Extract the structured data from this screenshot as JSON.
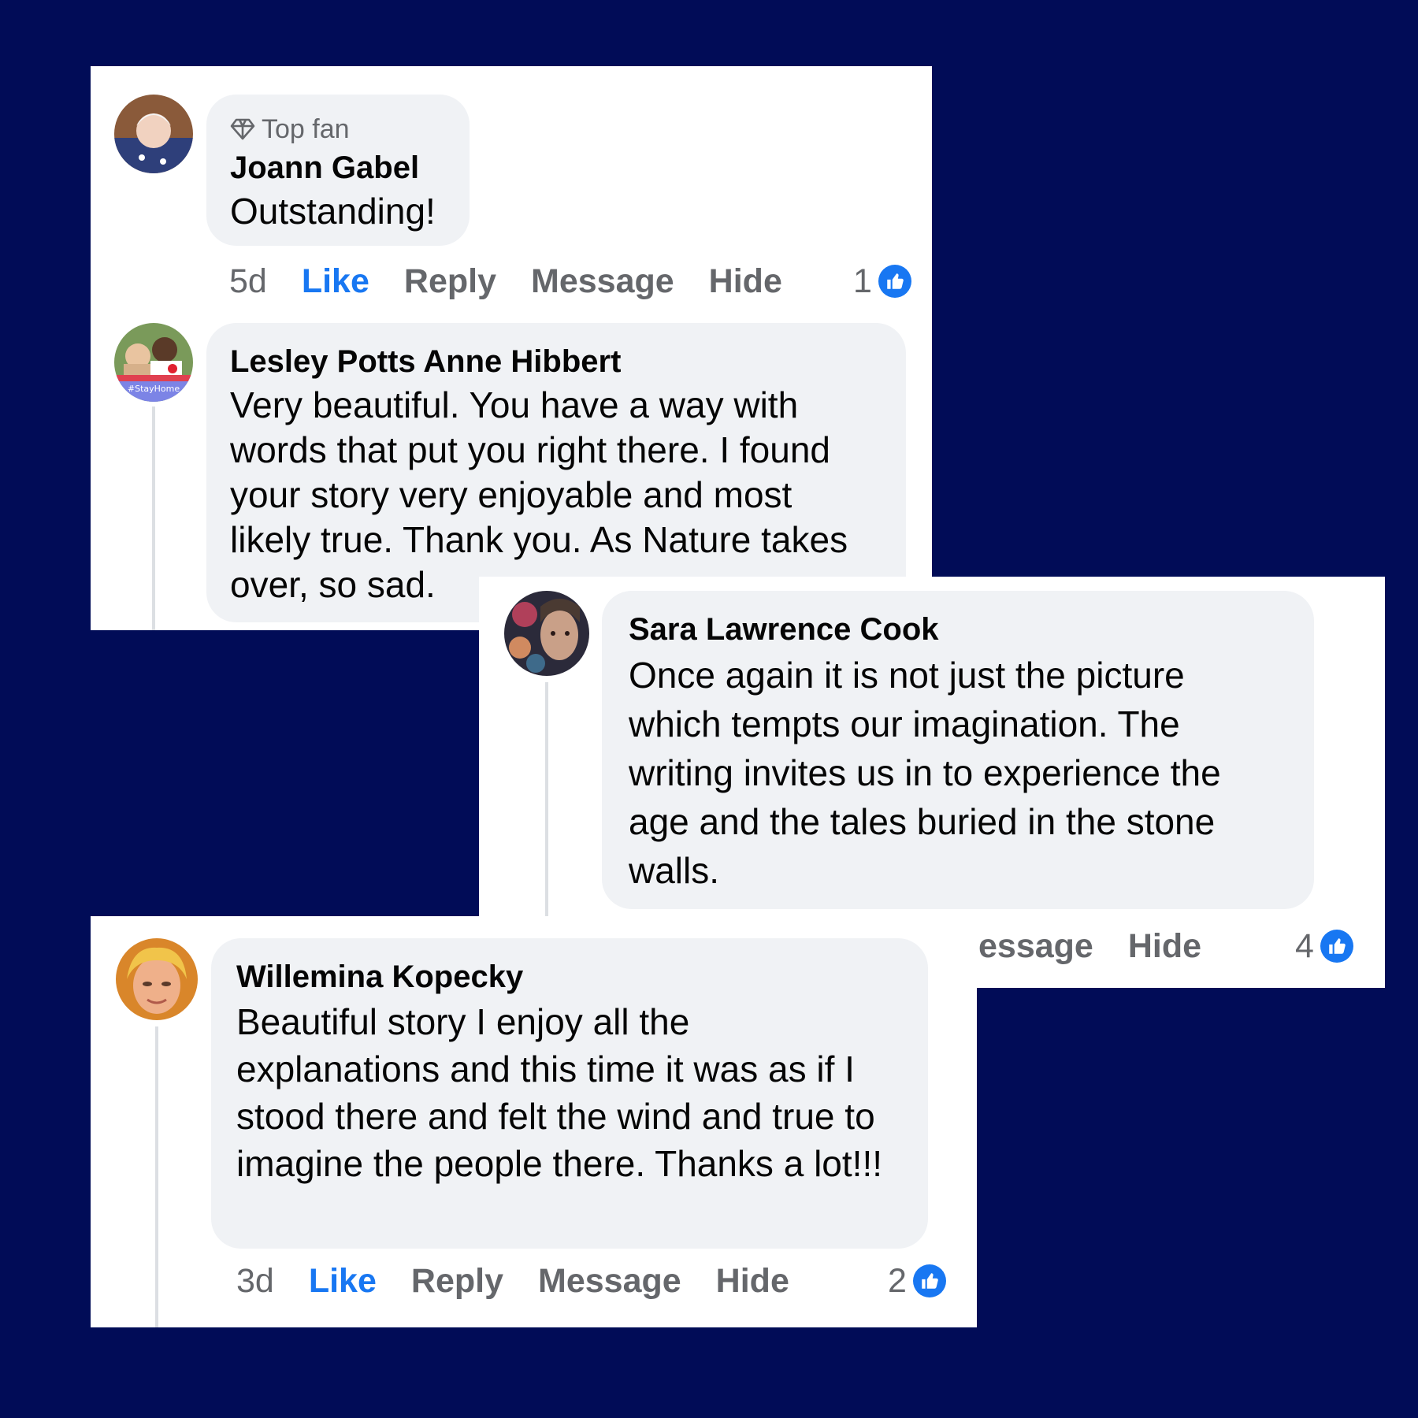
{
  "comments": [
    {
      "badge": "Top fan",
      "name": "Joann Gabel",
      "text": "Outstanding!",
      "time": "5d",
      "actions": {
        "like": "Like",
        "reply": "Reply",
        "message": "Message",
        "hide": "Hide"
      },
      "reaction_count": "1"
    },
    {
      "name": "Lesley Potts Anne Hibbert",
      "text": "Very beautiful.  You have a way with words that put you right there.  I found your story very enjoyable and most likely true.  Thank you.  As Nature takes over, so sad.",
      "avatar_text": "#StayHome"
    },
    {
      "name": "Sara Lawrence Cook",
      "text": "Once again it is not just the picture which tempts our imagination. The writing invites us in to experience the age and the tales buried in the stone walls.",
      "actions": {
        "message_partial": "essage",
        "hide": "Hide"
      },
      "reaction_count": "4"
    },
    {
      "name": "Willemina Kopecky",
      "text": "Beautiful story I enjoy all the explanations and this time it was as if I stood there and felt the wind and true to imagine the people there. Thanks a lot!!!",
      "time": "3d",
      "actions": {
        "like": "Like",
        "reply": "Reply",
        "message": "Message",
        "hide": "Hide"
      },
      "reaction_count": "2"
    }
  ],
  "colors": {
    "background": "#010c57",
    "like_blue": "#1877f2",
    "bubble": "#f0f2f5",
    "secondary_text": "#65676b"
  }
}
